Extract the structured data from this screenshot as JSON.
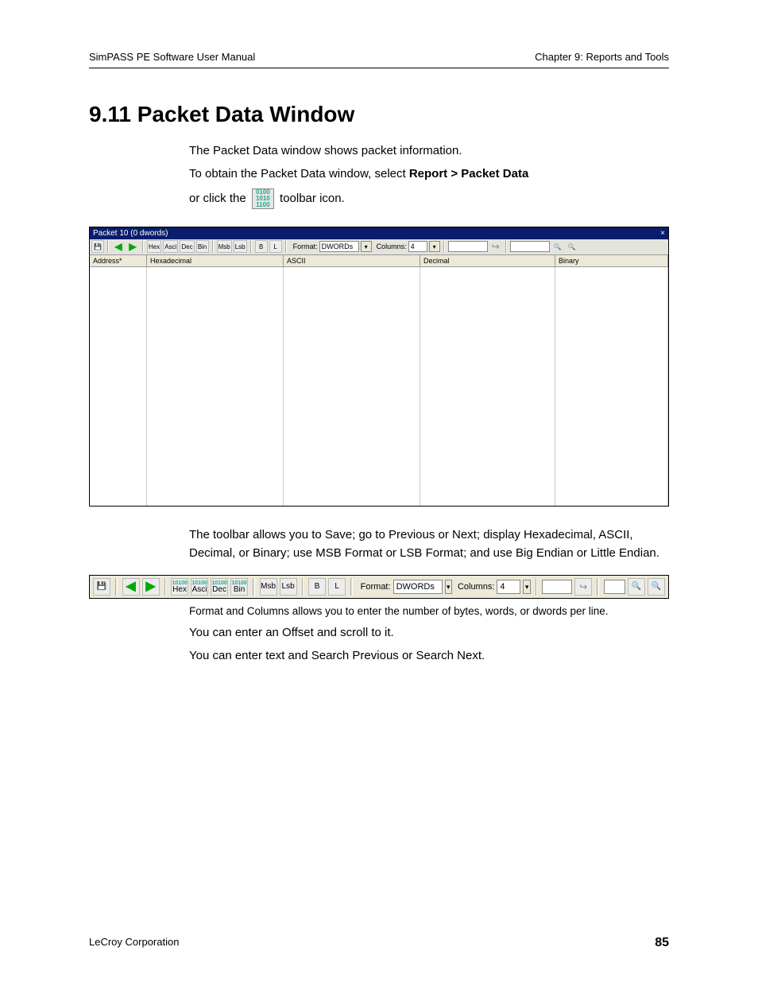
{
  "header": {
    "left": "SimPASS PE Software User Manual",
    "right": "Chapter 9: Reports and Tools"
  },
  "title": "9.11 Packet Data Window",
  "intro": {
    "p1": "The Packet Data window shows packet information.",
    "p2_a": "To obtain the Packet Data window, select ",
    "p2_b": "Report > Packet Data",
    "p3_a": "or click the ",
    "p3_b": " toolbar icon."
  },
  "icon_bits": {
    "l1": "0100",
    "l2": "1010",
    "l3": "1100"
  },
  "win1": {
    "title": "Packet 10 (0 dwords)",
    "close": "×",
    "buttons": {
      "hex": "Hex",
      "asci": "Asci",
      "dec": "Dec",
      "bin": "Bin",
      "msb": "Msb",
      "lsb": "Lsb",
      "big": "B",
      "lit": "L"
    },
    "format_label": "Format:",
    "format_value": "DWORDs",
    "columns_label": "Columns:",
    "columns_value": "4",
    "cols": {
      "addr": "Address*",
      "hex": "Hexadecimal",
      "ascii": "ASCII",
      "dec": "Decimal",
      "bin": "Binary"
    }
  },
  "desc1": "The toolbar allows you to Save; go to Previous or Next; display Hexadecimal, ASCII, Decimal, or Binary; use MSB Format or LSB Format; and use Big Endian or Little Endian.",
  "tb2": {
    "hex": "Hex",
    "asci": "Asci",
    "dec": "Dec",
    "bin": "Bin",
    "msb": "Msb",
    "lsb": "Lsb",
    "big": "B",
    "lit": "L",
    "sub": "10100",
    "format_label": "Format:",
    "format_value": "DWORDs",
    "columns_label": "Columns:",
    "columns_value": "4"
  },
  "desc2": "Format and Columns allows you to enter the number of bytes, words, or dwords per line.",
  "desc3": "You can enter an Offset and scroll to it.",
  "desc4": "You can enter text and Search Previous or Search Next.",
  "footer": {
    "left": "LeCroy Corporation",
    "page": "85"
  }
}
